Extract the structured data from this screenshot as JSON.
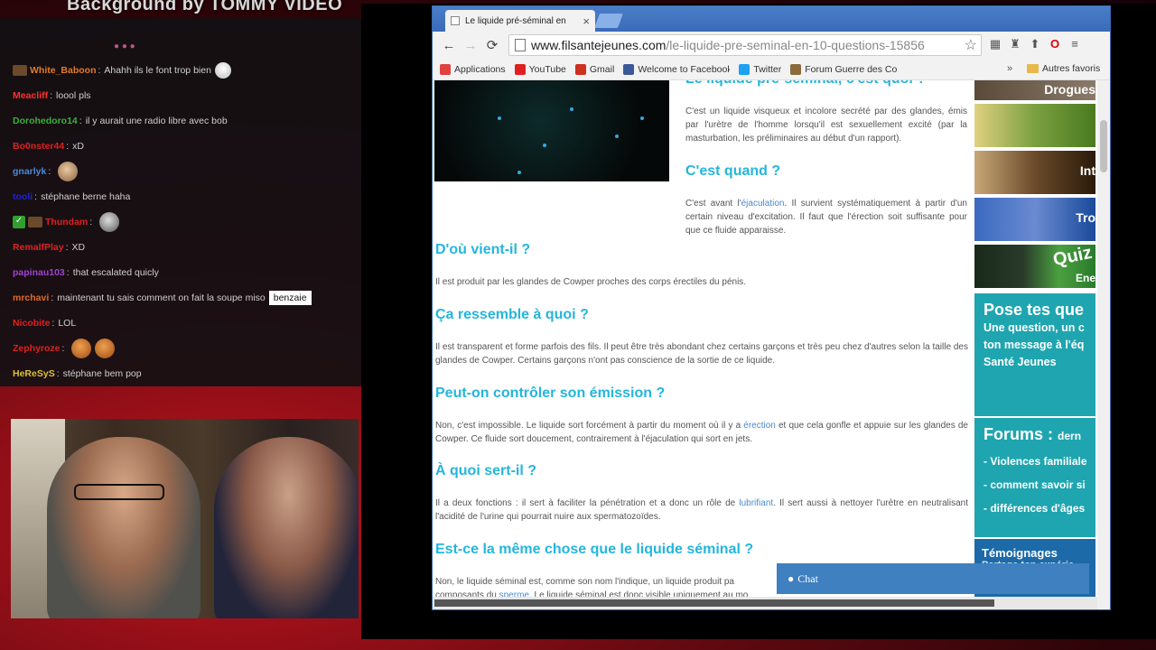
{
  "overlay": {
    "title": "Background by TOMMY VIDEO"
  },
  "chat": {
    "messages": [
      {
        "user": "White_Baboon",
        "color": "#e07a2a",
        "text": "Ahahh ils le font trop bien",
        "badge": "box",
        "emote": "mask"
      },
      {
        "user": "Meacliff",
        "color": "#ff3030",
        "text": "loool pls"
      },
      {
        "user": "Dorohedoro14",
        "color": "#3ab03a",
        "text": "il y aurait une radio libre avec bob"
      },
      {
        "user": "Bo0nster44",
        "color": "#e02020",
        "text": "xD"
      },
      {
        "user": "gnarlyk",
        "color": "#4a8ad8",
        "text": "",
        "emote": "face"
      },
      {
        "user": "tooli",
        "color": "#2020d0",
        "text": "stéphane berne haha"
      },
      {
        "user": "Thundam",
        "color": "#e02020",
        "text": "",
        "badge": "check",
        "emote": "gray"
      },
      {
        "user": "RemalfPlay",
        "color": "#e02020",
        "text": "XD"
      },
      {
        "user": "papinau103",
        "color": "#a040d0",
        "text": "that escalated quicly"
      },
      {
        "user": "mrchavi",
        "color": "#e06a2a",
        "text": "maintenant tu sais comment on fait la soupe miso",
        "tag": "benzaie"
      },
      {
        "user": "Nicobite",
        "color": "#e02020",
        "text": "LOL"
      },
      {
        "user": "Zephyroze",
        "color": "#e02020",
        "text": "",
        "emote": "orange"
      },
      {
        "user": "HeReSyS",
        "color": "#e0c030",
        "text": "stéphane bem pop"
      }
    ]
  },
  "browser": {
    "tab_title": "Le liquide pré-séminal en",
    "url_host": "www.filsantejeunes.com",
    "url_path": "/le-liquide-pre-seminal-en-10-questions-15856",
    "bookmarks": [
      {
        "label": "Applications",
        "icon_color": "#e04040"
      },
      {
        "label": "YouTube",
        "icon_color": "#e02020"
      },
      {
        "label": "Gmail",
        "icon_color": "#d03020"
      },
      {
        "label": "Welcome to Facebook",
        "icon_color": "#3b5998"
      },
      {
        "label": "Twitter",
        "icon_color": "#1da1f2"
      },
      {
        "label": "Forum Guerre des Co",
        "icon_color": "#8a6a3a"
      }
    ],
    "bookmarks_more": "»",
    "other_bookmarks": "Autres favoris"
  },
  "article": {
    "h0": "Le liquide pré-séminal, c'est quoi ?",
    "p0": "C'est un liquide visqueux et incolore secrété par des glandes, émis par l'urètre de l'homme lorsqu'il est sexuellement excité (par la masturbation, les préliminaires au début d'un rapport).",
    "h1": "C'est quand ?",
    "p1a": "C'est avant l'",
    "p1link": "éjaculation",
    "p1b": ". Il survient systématiquement à partir d'un certain niveau d'excitation. Il faut que l'érection soit suffisante pour que ce fluide apparaisse.",
    "h2": "D'où vient-il ?",
    "p2": "Il est produit par les glandes de Cowper proches des corps érectiles du pénis.",
    "h3": "Ça ressemble à quoi ?",
    "p3": "Il est transparent et forme parfois des fils. Il peut être très abondant chez certains garçons et très peu chez d'autres selon la taille des glandes de Cowper. Certains garçons n'ont pas conscience de la sortie de ce liquide.",
    "h4": "Peut-on contrôler son émission ?",
    "p4a": "Non, c'est impossible. Le liquide sort forcément à partir du moment où il y a ",
    "p4link": "érection",
    "p4b": " et que cela gonfle et appuie sur les glandes de Cowper. Ce fluide sort doucement, contrairement à l'éjaculation qui sort en jets.",
    "h5": "À quoi sert-il ?",
    "p5a": "Il a deux fonctions : il sert à faciliter la pénétration et a donc un rôle de ",
    "p5link": "lubrifiant",
    "p5b": ". Il sert aussi à nettoyer l'urètre en neutralisant l'acidité de l'urine qui pourrait nuire aux spermatozoïdes.",
    "h6": "Est-ce la même chose que le liquide séminal ?",
    "p6a": "Non, le liquide séminal est, comme son nom l'indique, un liquide produit pa",
    "p6b": "composants du ",
    "p6link": "sperme",
    "p6c": ". Le liquide séminal est donc visible uniquement au mo"
  },
  "sidebar": {
    "tile_drogues": "Drogues",
    "tile_int": "Int",
    "tile_tro": "Tro",
    "tile_quiz": "Quiz",
    "tile_ene": "Ene",
    "promo_title": "Pose tes que",
    "promo_lines": [
      "Une question, un c",
      "ton message à l'éq",
      "Santé Jeunes"
    ],
    "forums_title": "Forums :",
    "forums_sub": "dern",
    "forums_items": [
      "- Violences familiale",
      "- comment savoir si",
      "- différences d'âges"
    ],
    "temoignages_title": "Témoignages",
    "temoignages_sub": "Partage ton expérie"
  },
  "chat_widget": {
    "label": "Chat"
  }
}
